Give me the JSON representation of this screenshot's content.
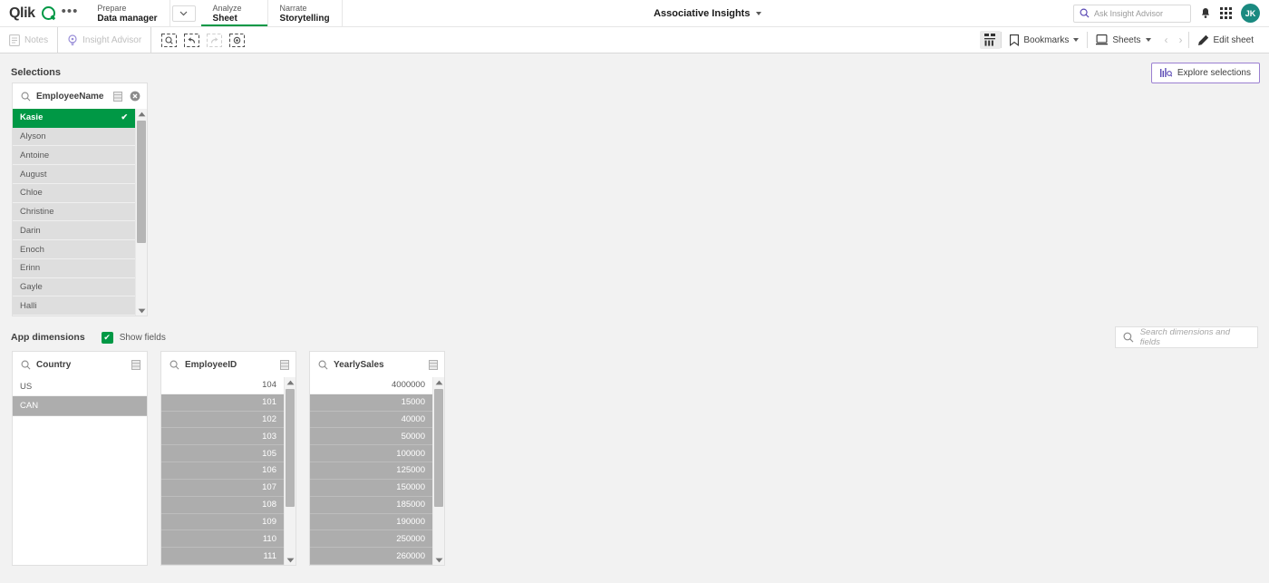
{
  "topnav": {
    "logo_text": "Qlik",
    "overflow_label": "•••",
    "sections": [
      {
        "kicker": "Prepare",
        "main": "Data manager",
        "active": false
      },
      {
        "kicker": "Analyze",
        "main": "Sheet",
        "active": true
      },
      {
        "kicker": "Narrate",
        "main": "Storytelling",
        "active": false
      }
    ],
    "app_title": "Associative Insights",
    "insight_search_placeholder": "Ask Insight Advisor",
    "avatar_initials": "JK"
  },
  "toolbar": {
    "notes_label": "Notes",
    "insight_advisor_label": "Insight Advisor",
    "selection_tools": [
      {
        "name": "selection-search-tool",
        "enabled": true
      },
      {
        "name": "step-back-tool",
        "enabled": true
      },
      {
        "name": "step-forward-tool",
        "enabled": false
      },
      {
        "name": "clear-selections-tool",
        "enabled": true
      }
    ],
    "bookmarks_label": "Bookmarks",
    "sheets_label": "Sheets",
    "edit_sheet_label": "Edit sheet"
  },
  "selections": {
    "title": "Selections",
    "explore_button_label": "Explore selections",
    "explore_button_border_color": "#9a7fd1"
  },
  "app_dimensions": {
    "label": "App dimensions",
    "show_fields_label": "Show fields",
    "show_fields_checked": true,
    "search_placeholder": "Search dimensions and fields"
  },
  "colors": {
    "selected_green": "#009845",
    "excluded_gray": "#adadad",
    "alternative_gray": "#dedede",
    "page_background": "#f2f2f2",
    "avatar_teal": "#1a8a80"
  },
  "selection_listbox": {
    "field": "EmployeeName",
    "rows": [
      {
        "label": "Kasie",
        "state": "selected"
      },
      {
        "label": "Alyson",
        "state": "altlist"
      },
      {
        "label": "Antoine",
        "state": "altlist"
      },
      {
        "label": "August",
        "state": "altlist"
      },
      {
        "label": "Chloe",
        "state": "altlist"
      },
      {
        "label": "Christine",
        "state": "altlist"
      },
      {
        "label": "Darin",
        "state": "altlist"
      },
      {
        "label": "Enoch",
        "state": "altlist"
      },
      {
        "label": "Erinn",
        "state": "altlist"
      },
      {
        "label": "Gayle",
        "state": "altlist"
      },
      {
        "label": "Halli",
        "state": "altlist"
      }
    ]
  },
  "dimension_listboxes": [
    {
      "field": "Country",
      "numeric": false,
      "scrollbar": false,
      "rows": [
        {
          "label": "US",
          "state": "alt"
        },
        {
          "label": "CAN",
          "state": "excluded"
        }
      ]
    },
    {
      "field": "EmployeeID",
      "numeric": true,
      "scrollbar": true,
      "rows": [
        {
          "label": "104",
          "state": "alt"
        },
        {
          "label": "101",
          "state": "excluded"
        },
        {
          "label": "102",
          "state": "excluded"
        },
        {
          "label": "103",
          "state": "excluded"
        },
        {
          "label": "105",
          "state": "excluded"
        },
        {
          "label": "106",
          "state": "excluded"
        },
        {
          "label": "107",
          "state": "excluded"
        },
        {
          "label": "108",
          "state": "excluded"
        },
        {
          "label": "109",
          "state": "excluded"
        },
        {
          "label": "110",
          "state": "excluded"
        },
        {
          "label": "111",
          "state": "excluded"
        }
      ]
    },
    {
      "field": "YearlySales",
      "numeric": true,
      "scrollbar": true,
      "rows": [
        {
          "label": "4000000",
          "state": "alt"
        },
        {
          "label": "15000",
          "state": "excluded"
        },
        {
          "label": "40000",
          "state": "excluded"
        },
        {
          "label": "50000",
          "state": "excluded"
        },
        {
          "label": "100000",
          "state": "excluded"
        },
        {
          "label": "125000",
          "state": "excluded"
        },
        {
          "label": "150000",
          "state": "excluded"
        },
        {
          "label": "185000",
          "state": "excluded"
        },
        {
          "label": "190000",
          "state": "excluded"
        },
        {
          "label": "250000",
          "state": "excluded"
        },
        {
          "label": "260000",
          "state": "excluded"
        }
      ]
    }
  ]
}
